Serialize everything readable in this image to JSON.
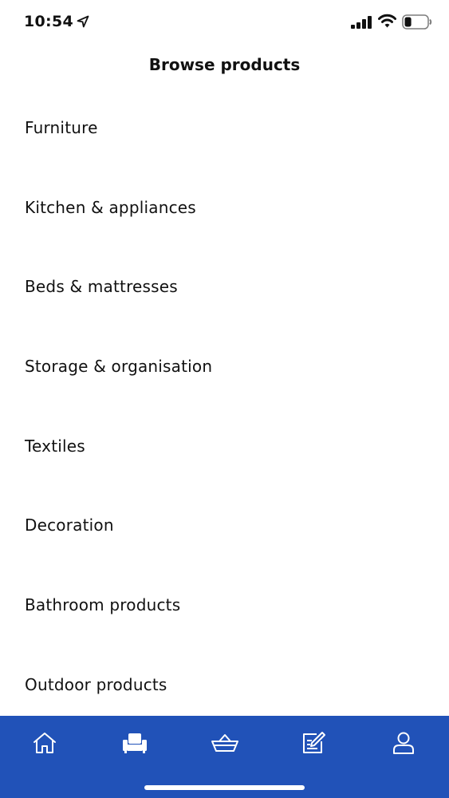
{
  "status_bar": {
    "time": "10:54",
    "location_icon": "location-arrow-icon",
    "signal_icon": "cellular-signal-icon",
    "wifi_icon": "wifi-icon",
    "battery_icon": "battery-icon",
    "battery_level": 0.3
  },
  "header": {
    "title": "Browse products"
  },
  "categories": [
    {
      "label": "Furniture"
    },
    {
      "label": "Kitchen & appliances"
    },
    {
      "label": "Beds & mattresses"
    },
    {
      "label": "Storage & organisation"
    },
    {
      "label": "Textiles"
    },
    {
      "label": "Decoration"
    },
    {
      "label": "Bathroom products"
    },
    {
      "label": "Outdoor products"
    }
  ],
  "tab_bar": {
    "background": "#2152b8",
    "active_tab": "products",
    "tabs": [
      {
        "id": "home",
        "icon": "home-icon"
      },
      {
        "id": "products",
        "icon": "armchair-icon"
      },
      {
        "id": "basket",
        "icon": "basket-icon"
      },
      {
        "id": "list",
        "icon": "edit-list-icon"
      },
      {
        "id": "profile",
        "icon": "user-icon"
      }
    ]
  }
}
